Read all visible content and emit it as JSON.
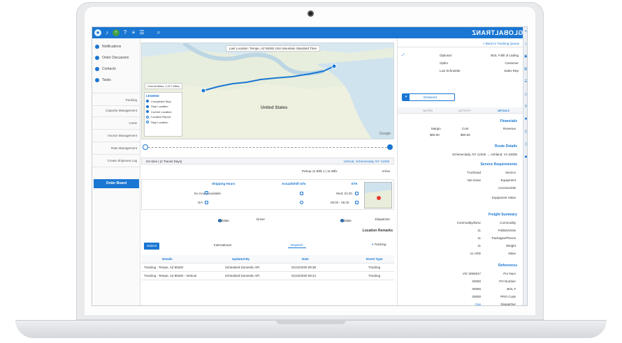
{
  "topbar": {
    "brand": "GLOBALTRANZ",
    "icons": [
      "avatar-icon",
      "bell-icon",
      "plus-icon",
      "help-icon",
      "menu-icon",
      "list-icon",
      "search-icon"
    ]
  },
  "leftnav": {
    "items": [
      {
        "label": "Notifications",
        "icon": "bell-icon"
      },
      {
        "label": "Order Discussion",
        "icon": "chat-icon"
      },
      {
        "label": "Contacts",
        "icon": "contacts-icon"
      },
      {
        "label": "Tasks",
        "icon": "tasks-icon"
      }
    ],
    "links": [
      "Tracking",
      "Capacity Management",
      "Costs",
      "Invoice Management",
      "Rate Management",
      "Create Shipment Log"
    ],
    "order_board_label": "Order Board"
  },
  "map": {
    "address": "Last Location: Tempe, AZ 85282 USA Mountain Standard Time",
    "overall_label": "Overall Miles: 2,377 Miles",
    "legend_title": "LEGEND",
    "legend_items": [
      "Completed Stop",
      "Stop Location",
      "Current Location",
      "Location Report",
      "Stop Location"
    ],
    "country_label": "United States",
    "google_label": "Google"
  },
  "info_bar": {
    "left": "Vertical, Schenectady, NY 12345",
    "right": "On-time   |   (2 Transit Days)"
  },
  "pickup": {
    "left": "Arrive",
    "right": "Pickup 11 Bills 1 | 11 Bills"
  },
  "cards": [
    {
      "heading": "ETA",
      "lines": [
        "Wed, 02:30",
        "08:00 - 08:30"
      ]
    },
    {
      "heading": "Actual/Shift Info",
      "lines": [
        ""
      ]
    },
    {
      "heading": "Shipping Hours",
      "lines": [
        "No Hours available",
        "N/A"
      ]
    }
  ],
  "status_row": {
    "dispatcher_label": "Dispatcher",
    "dispatcher_value": "Validate",
    "driver_label": "Driver",
    "driver_value": "Validate"
  },
  "remarks": {
    "title": "Location Remarks",
    "tabs": [
      "Dispatch",
      "International"
    ],
    "submit_label": "Submit",
    "tracking_label": "Tracking"
  },
  "table": {
    "headers": [
      "Event Type",
      "Date",
      "Updated By",
      "Details"
    ],
    "rows": [
      [
        "Tracking",
        "01/24/2020 09:38",
        "Scheduled Domestic API",
        "Tracking - Tempe, AZ 85282"
      ],
      [
        "Tracking",
        "01/24/2020 09:24",
        "Scheduled Domestic API",
        "Tracking - Tempe, AZ 85282 - Vertical"
      ]
    ]
  },
  "rightpanel": {
    "back_label": "< Back to Tracking Queue",
    "fields": [
      {
        "label": "BOL # Bill of Lading",
        "value": "Optional"
      },
      {
        "label": "Customer",
        "value": "Optim"
      },
      {
        "label": "Sales Rep",
        "value": "Luis Schneider"
      }
    ],
    "status_label": "Delivered",
    "tabs": [
      "DETAILS",
      "ACTIVITY",
      "NOTES"
    ],
    "financials_title": "Financials",
    "financials": [
      {
        "label": "Revenue",
        "cost": "Cost",
        "margin": "Margin"
      },
      {
        "label": "",
        "cost": "$00.00",
        "margin": "$00.00"
      }
    ],
    "route_title": "Route Details",
    "route_line": "Schenectady, NY 12345 → Ashland, VA 23005",
    "service_title": "Service Requirements",
    "service": [
      {
        "label": "Service",
        "value": "Truckload"
      },
      {
        "label": "Equipment",
        "value": "Van None"
      },
      {
        "label": "Accessorials",
        "value": ""
      },
      {
        "label": "Equipment Value",
        "value": ""
      }
    ],
    "freight_title": "Freight Summary",
    "freight": [
      {
        "label": "Commodity",
        "value": "Commodity/Desc"
      },
      {
        "label": "Pallets/Units",
        "value": "11"
      },
      {
        "label": "Packages/Pieces",
        "value": "11"
      },
      {
        "label": "Weight",
        "value": "11"
      },
      {
        "label": "Value",
        "value": "11 USD"
      }
    ],
    "references_title": "References",
    "references": [
      {
        "label": "Pro Num",
        "value": "VIC 0092547"
      },
      {
        "label": "PO Number",
        "value": "00000"
      },
      {
        "label": "BOL #",
        "value": "00000"
      },
      {
        "label": "PRO Code",
        "value": "00000"
      },
      {
        "label": "Dispatcher",
        "value": "Cap"
      },
      {
        "label": "Driver",
        "value": ""
      }
    ]
  },
  "colors": {
    "accent": "#1976d2",
    "nav_button": "#1976d2"
  }
}
